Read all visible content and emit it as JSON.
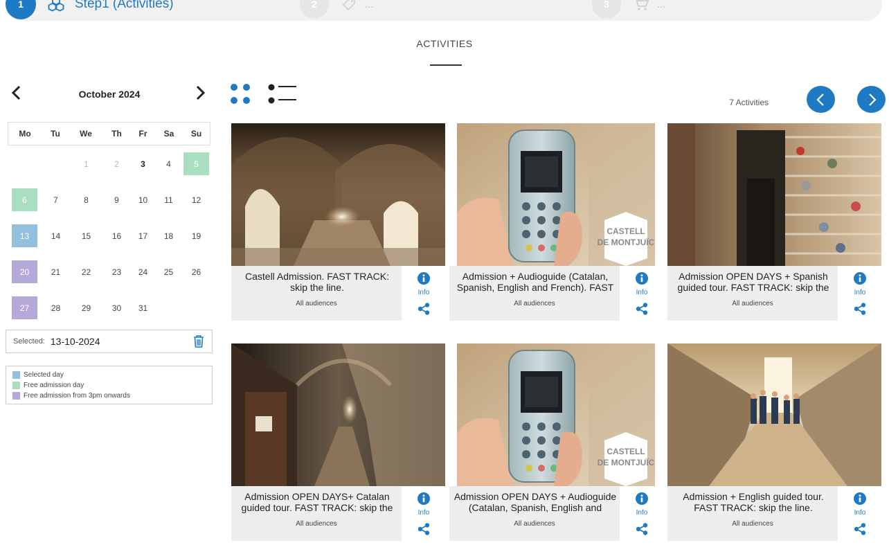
{
  "stepper": {
    "steps": [
      {
        "number": "1",
        "label": "Step1 (Activities)",
        "icon": "cubes-icon",
        "active": true
      },
      {
        "number": "2",
        "label": "...",
        "icon": "ticket-icon",
        "active": false
      },
      {
        "number": "3",
        "label": "...",
        "icon": "cart-icon",
        "active": false
      }
    ]
  },
  "section_title": "ACTIVITIES",
  "calendar": {
    "month_label": "October 2024",
    "weekdays": [
      "Mo",
      "Tu",
      "We",
      "Th",
      "Fr",
      "Sa",
      "Su"
    ],
    "days": [
      "1",
      "2",
      "3",
      "4",
      "5",
      "6",
      "7",
      "8",
      "9",
      "10",
      "11",
      "12",
      "13",
      "14",
      "15",
      "16",
      "17",
      "18",
      "19",
      "20",
      "21",
      "22",
      "23",
      "24",
      "25",
      "26",
      "27",
      "28",
      "29",
      "30",
      "31"
    ],
    "past_days": [
      "1",
      "2"
    ],
    "today": "3",
    "free_days": [
      "5",
      "6"
    ],
    "selected_day": "13",
    "afternoon_free_days": [
      "20",
      "27"
    ],
    "colors": {
      "selected": "#94bfdf",
      "free": "#a9dfc0",
      "afternoon_free": "#b5a9da"
    }
  },
  "selected": {
    "label": "Selected:",
    "value": "13-10-2024"
  },
  "legend": [
    {
      "label": "Selected day",
      "color": "#94bfdf"
    },
    {
      "label": "Free admission day",
      "color": "#a9dfc0"
    },
    {
      "label": "Free admission from 3pm onwards",
      "color": "#b5a9da"
    }
  ],
  "activities": {
    "count_label": "7 Activities",
    "info_label": "Info",
    "items": [
      {
        "title": "Castell Admission. FAST TRACK: skip the line.",
        "audience": "All audiences",
        "image": "stone-archway-corridor"
      },
      {
        "title": "Admission + Audioguide (Catalan, Spanish, English and French). FAST TRACK: skip the line.",
        "audience": "All audiences",
        "image": "audioguide-device",
        "badge_line1": "CASTELL",
        "badge_line2": "DE MONTJUÏC"
      },
      {
        "title": "Admission OPEN DAYS + Spanish guided tour. FAST TRACK: skip the line.",
        "audience": "All audiences",
        "image": "staircase-visitors"
      },
      {
        "title": "Admission OPEN DAYS+ Catalan guided tour. FAST TRACK: skip the line.",
        "audience": "All audiences",
        "image": "dungeon-corridor"
      },
      {
        "title": "Admission OPEN DAYS + Audioguide (Catalan, Spanish, English and French). FAST TRACK: skip the line.",
        "audience": "All audiences",
        "image": "audioguide-device",
        "badge_line1": "CASTELL",
        "badge_line2": "DE MONTJUÏC"
      },
      {
        "title": "Admission + English guided tour. FAST TRACK: skip the line.",
        "audience": "All audiences",
        "image": "tunnel-group"
      }
    ]
  },
  "colors": {
    "accent": "#1f7ac4"
  }
}
